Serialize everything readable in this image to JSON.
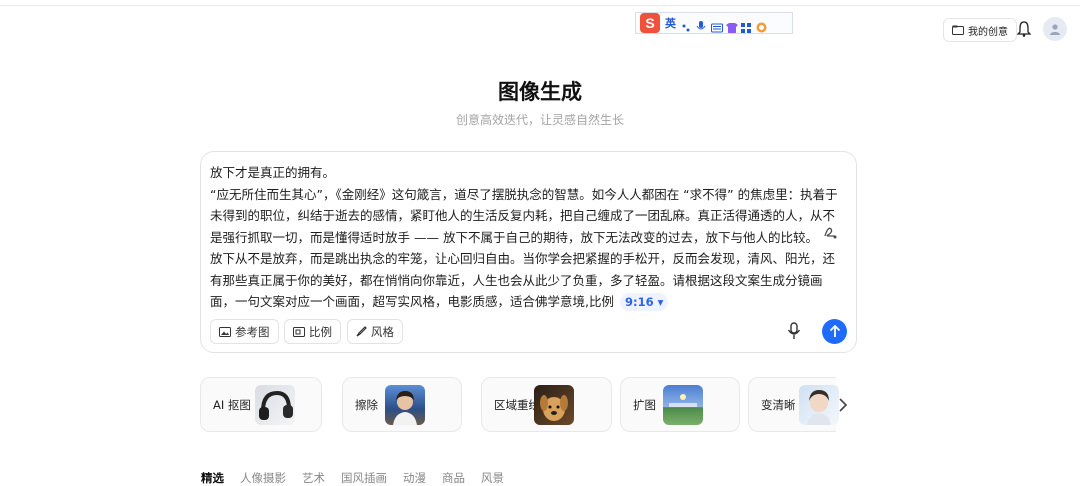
{
  "ime": {
    "logo_letter": "S",
    "mode_label": "英"
  },
  "header": {
    "my_creations_label": "我的创意"
  },
  "hero": {
    "title": "图像生成",
    "subtitle": "创意高效迭代，让灵感自然生长"
  },
  "prompt": {
    "line1": "放下才是真正的拥有。",
    "line2": "“应无所住而生其心”，《金刚经》这句箴言，道尽了摆脱执念的智慧。如今人人都困在 “求不得” 的焦虑里：执着于未得到的职位，纠结于逝去的感情，紧盯他人的生活反复内耗，把自己缠成了一团乱麻。真正活得通透的人，从不是强行抓取一切，而是懂得适时放手 —— 放下不属于自己的期待，放下无法改变的过去，放下与他人的比较。",
    "line3": "放下从不是放弃，而是跳出执念的牢笼，让心回归自由。当你学会把紧握的手松开，反而会发现，清风、阳光，还有那些真正属于你的美好，都在悄悄向你靠近，人生也会从此少了负重，多了轻盈。请根据这段文案生成分镜画面，一句文案对应一个画面，超写实风格，电影质感，适合佛学意境,比例",
    "ratio_chip": "9:16",
    "buttons": {
      "reference": "参考图",
      "ratio": "比例",
      "style": "风格"
    }
  },
  "tools": [
    {
      "label": "AI 抠图"
    },
    {
      "label": "擦除"
    },
    {
      "label": "区域重绘"
    },
    {
      "label": "扩图"
    },
    {
      "label": "变清晰"
    }
  ],
  "tabs": [
    "精选",
    "人像摄影",
    "艺术",
    "国风插画",
    "动漫",
    "商品",
    "风景"
  ],
  "colors": {
    "accent": "#1f6bff",
    "ime_logo": "#f0513a"
  }
}
